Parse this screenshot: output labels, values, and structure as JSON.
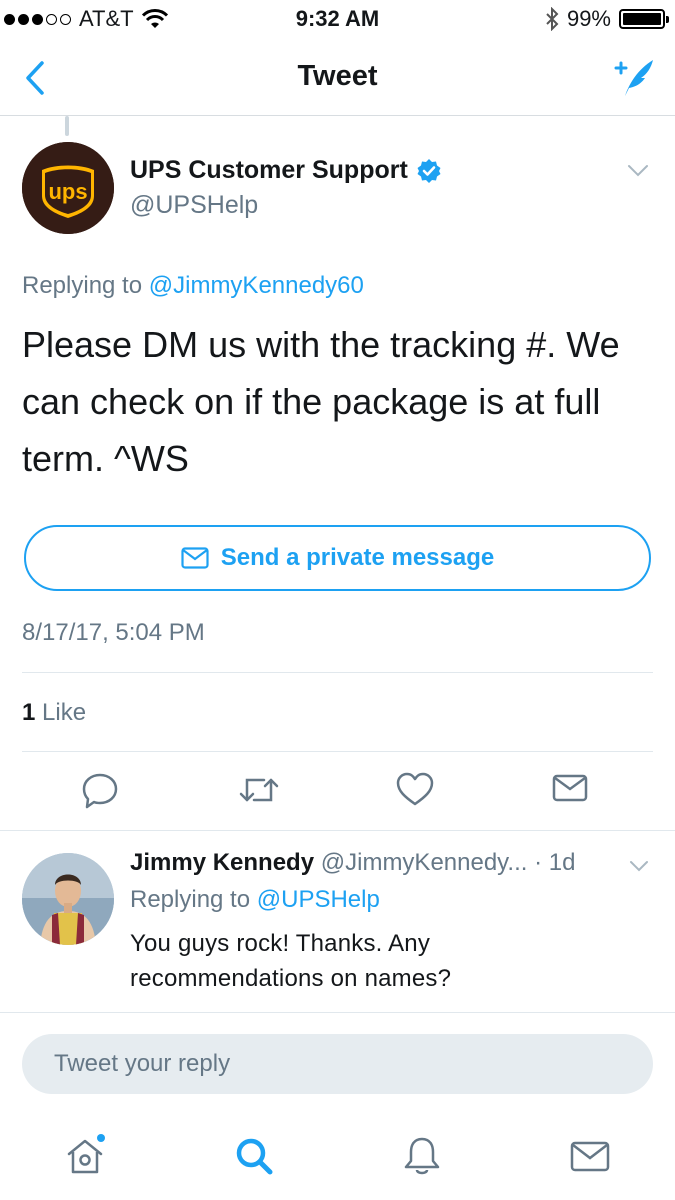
{
  "status_bar": {
    "carrier": "AT&T",
    "time": "9:32 AM",
    "battery": "99%"
  },
  "nav": {
    "title": "Tweet",
    "back_icon": "chevron-left-icon",
    "compose_icon": "compose-quill-icon"
  },
  "tweet": {
    "author_name": "UPS Customer Support",
    "author_handle": "@UPSHelp",
    "verified": true,
    "replying_prefix": "Replying to",
    "replying_to": "@JimmyKennedy60",
    "text": "Please DM us with the tracking #. We can check on if the package is at full term. ^WS",
    "dm_button_label": "Send a private message",
    "timestamp": "8/17/17, 5:04 PM",
    "like_count": "1",
    "like_label": "Like",
    "actions": [
      "reply-icon",
      "retweet-icon",
      "heart-icon",
      "mail-icon"
    ]
  },
  "reply": {
    "author_name": "Jimmy Kennedy",
    "author_handle": "@JimmyKennedy...",
    "time": "· 1d",
    "replying_prefix": "Replying to",
    "replying_to": "@UPSHelp",
    "text": "You guys rock! Thanks. Any recommendations on names?"
  },
  "composer": {
    "placeholder": "Tweet your reply"
  },
  "tabbar": [
    "home-icon",
    "search-icon",
    "notifications-icon",
    "messages-icon"
  ],
  "colors": {
    "accent": "#1da1f2",
    "secondary_text": "#657786",
    "primary_text": "#14171a",
    "ups_brown": "#351c15",
    "ups_gold": "#ffb500"
  }
}
